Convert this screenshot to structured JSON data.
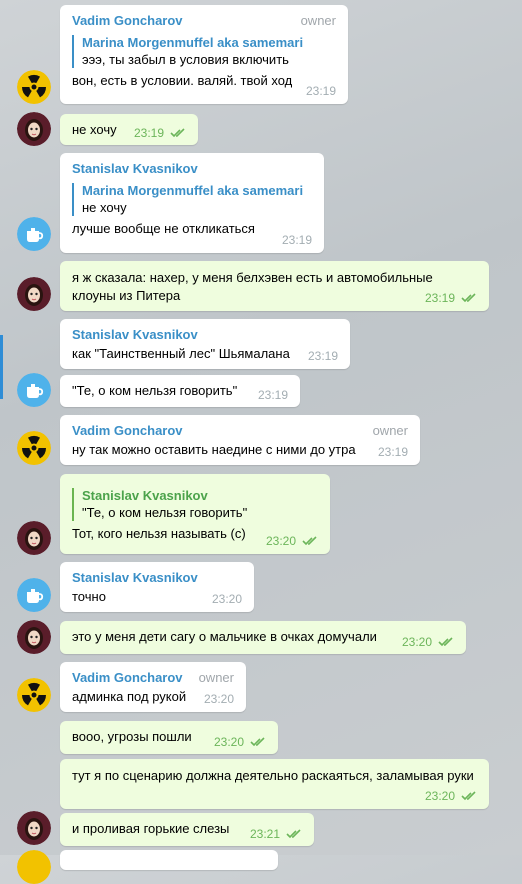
{
  "messages": [
    {
      "sender": "Vadim Goncharov",
      "role": "owner",
      "reply_name": "Marina Morgenmuffel aka samemari",
      "reply_text": "эээ, ты забыл в условия включить",
      "text": "вон, есть в условии. валяй. твой ход",
      "time": "23:19"
    },
    {
      "text": "не хочу",
      "time": "23:19"
    },
    {
      "sender": "Stanislav Kvasnikov",
      "reply_name": "Marina Morgenmuffel aka samemari",
      "reply_text": "не хочу",
      "text": "лучше вообще не откликаться",
      "time": "23:19"
    },
    {
      "text": "я ж сказала: нахер, у меня белхэвен есть и автомобильные клоуны из Питера",
      "time": "23:19"
    },
    {
      "sender": "Stanislav Kvasnikov",
      "text": "как \"Таинственный лес\" Шьямалана",
      "time": "23:19"
    },
    {
      "text": "\"Те, о ком нельзя говорить\"",
      "time": "23:19"
    },
    {
      "sender": "Vadim Goncharov",
      "role": "owner",
      "text": "ну так можно оставить наедине с ними до утра",
      "time": "23:19"
    },
    {
      "reply_name": "Stanislav Kvasnikov",
      "reply_text": "\"Те, о ком нельзя говорить\"",
      "text": "Тот, кого нельзя называть (с)",
      "time": "23:20"
    },
    {
      "sender": "Stanislav Kvasnikov",
      "text": "точно",
      "time": "23:20"
    },
    {
      "text": "это у меня дети сагу о мальчике в очках домучали",
      "time": "23:20"
    },
    {
      "sender": "Vadim Goncharov",
      "role": "owner",
      "text": "админка под рукой",
      "time": "23:20"
    },
    {
      "text": "вооо, угрозы пошли",
      "time": "23:20"
    },
    {
      "text": "тут я по сценарию должна деятельно раскаяться, заламывая руки",
      "time": "23:20"
    },
    {
      "text": "и проливая горькие слезы",
      "time": "23:21"
    }
  ],
  "colors": {
    "accent": "#3a8fc7",
    "outgoing_bubble": "#effdde",
    "read_check": "#6cb55a"
  },
  "icons": {
    "read": "double-check-icon",
    "radiation": "radiation-avatar",
    "teapot": "teapot-avatar",
    "woman": "woman-avatar"
  }
}
